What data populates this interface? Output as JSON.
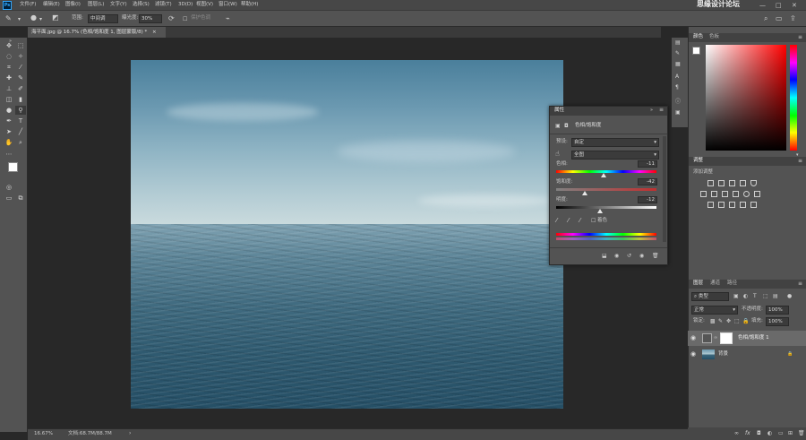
{
  "menubar": {
    "items": [
      "文件(F)",
      "编辑(E)",
      "图像(I)",
      "图层(L)",
      "文字(Y)",
      "选择(S)",
      "滤镜(T)",
      "3D(D)",
      "视图(V)",
      "窗口(W)",
      "帮助(H)"
    ],
    "app_icon": "Ps",
    "watermark": "思缘设计论坛",
    "window_controls": [
      "—",
      "□",
      "✕"
    ]
  },
  "options": {
    "range_label": "范围:",
    "range_value": "中间调",
    "exposure_label": "曝光度:",
    "exposure_value": "30%",
    "protect_label": "保护色调"
  },
  "document": {
    "tab_title": "海平面.jpg @ 16.7% (色相/饱和度 1, 图层蒙版/8) *",
    "close": "×"
  },
  "status": {
    "zoom": "16.67%",
    "doc_size": "文档:68.7M/88.7M",
    "arrow": "›"
  },
  "properties": {
    "panel_tab": "属性",
    "adjustment_name": "色相/饱和度",
    "preset_label": "预设:",
    "preset_value": "自定",
    "channel_value": "全图",
    "hue_label": "色相:",
    "hue_value": "-11",
    "saturation_label": "饱和度:",
    "saturation_value": "-42",
    "lightness_label": "明度:",
    "lightness_value": "-12",
    "colorize_label": "着色",
    "hue_fraction": 0.47,
    "saturation_fraction": 0.29,
    "lightness_fraction": 0.44
  },
  "color_panel": {
    "tabs": [
      "颜色",
      "色板"
    ]
  },
  "adjustments_panel": {
    "tab": "调整",
    "add_label": "添加调整"
  },
  "layers_panel": {
    "tabs": [
      "图层",
      "通道",
      "路径"
    ],
    "filter_label": "类型",
    "blend_mode": "正常",
    "opacity_label": "不透明度:",
    "opacity_value": "100%",
    "lock_label": "锁定:",
    "fill_label": "填充:",
    "fill_value": "100%",
    "layers": [
      {
        "name": "色相/饱和度 1",
        "visible": true
      },
      {
        "name": "背景",
        "visible": true
      }
    ],
    "footer_icons": [
      "link-icon",
      "fx-icon",
      "mask-icon",
      "adjustment-icon",
      "folder-icon",
      "new-layer-icon",
      "trash-icon"
    ]
  },
  "colors": {
    "accent": "#31a8ff",
    "foreground": "#ffffff",
    "background": "#000000"
  }
}
